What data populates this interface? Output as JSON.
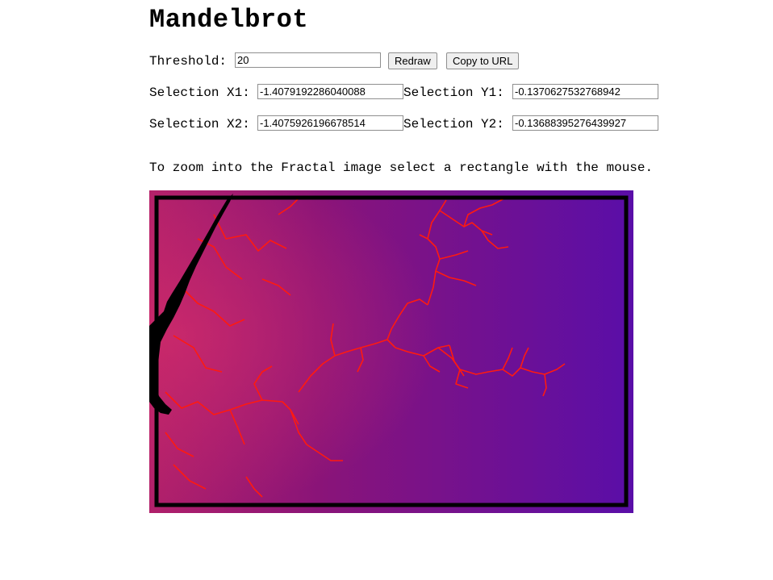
{
  "title": "Mandelbrot",
  "threshold": {
    "label": "Threshold:",
    "value": "20"
  },
  "buttons": {
    "redraw": "Redraw",
    "copy": "Copy to URL"
  },
  "selection": {
    "x1": {
      "label": "Selection X1:",
      "value": "-1.4079192286040088"
    },
    "y1": {
      "label": "Selection Y1:",
      "value": "-0.1370627532768942"
    },
    "x2": {
      "label": "Selection X2:",
      "value": "-1.4075926196678514"
    },
    "y2": {
      "label": "Selection Y2:",
      "value": "-0.13688395276439927"
    }
  },
  "hint": "To zoom into the Fractal image select a rectangle with the mouse.",
  "colors": {
    "fractal_left": "#b0206a",
    "fractal_right": "#5a0ea8",
    "filament": "#ff1a10",
    "selection": "#000000"
  }
}
